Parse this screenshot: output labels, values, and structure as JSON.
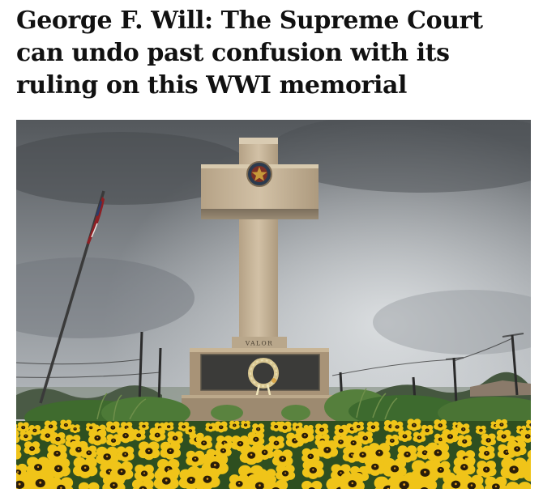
{
  "article": {
    "headline": "George F. Will: The Supreme Court can undo past confusion with its ruling on this WWI memorial",
    "photo": {
      "inscription": "VALOR"
    }
  },
  "colors": {
    "headline_text": "#111111",
    "sky_top": "#5d6064",
    "sky_bottom": "#c9cdd1",
    "monument_stone": "#c9b79c",
    "plaque": "#3a3a38",
    "pansy_yellow": "#f0c419",
    "pansy_dark": "#2a1d08",
    "foliage": "#3e6a2c"
  }
}
